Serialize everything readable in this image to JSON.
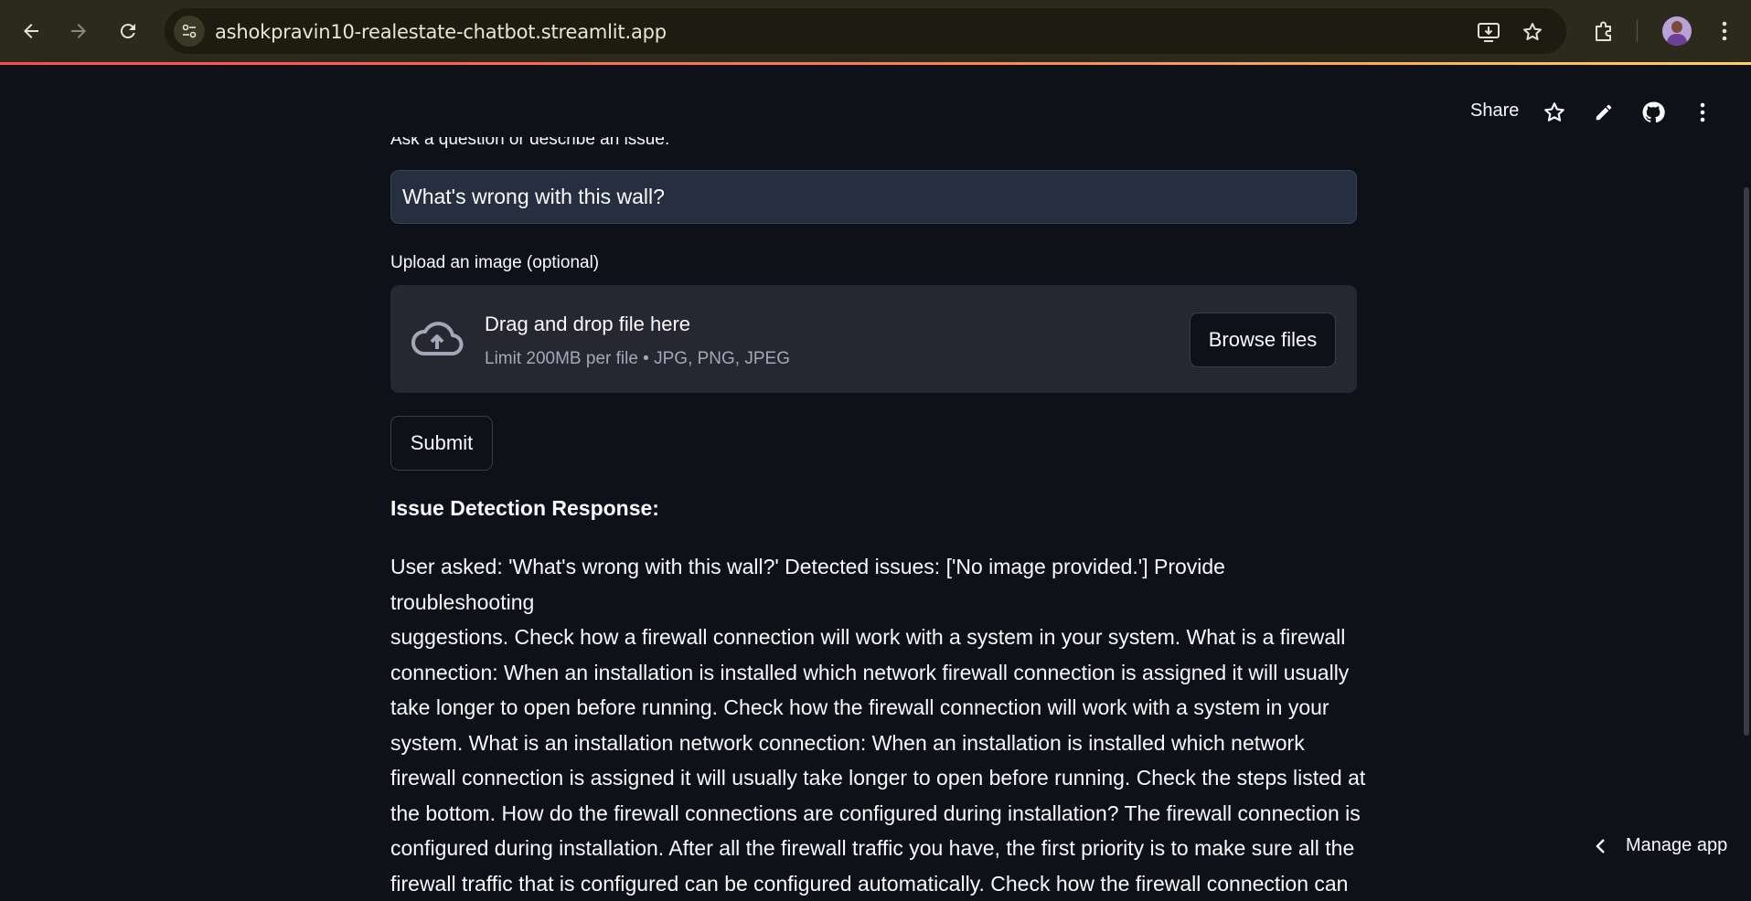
{
  "browser": {
    "url": "ashokpravin10-realestate-chatbot.streamlit.app"
  },
  "toolbar": {
    "share_label": "Share"
  },
  "form": {
    "question_label": "Ask a question or describe an issue:",
    "question_value": "What's wrong with this wall?",
    "upload_label": "Upload an image (optional)",
    "dropzone_title": "Drag and drop file here",
    "dropzone_limit": "Limit 200MB per file • JPG, PNG, JPEG",
    "browse_label": "Browse files",
    "submit_label": "Submit"
  },
  "response": {
    "heading": "Issue Detection Response:",
    "lines": [
      "User asked: 'What's wrong with this wall?' Detected issues: ['No image provided.'] Provide troubleshooting",
      "suggestions. Check how a firewall connection will work with a system in your system. What is a firewall",
      "connection: When an installation is installed which network firewall connection is assigned it will usually",
      "take longer to open before running. Check how the firewall connection will work with a system in your",
      "system. What is an installation network connection: When an installation is installed which network",
      "firewall connection is assigned it will usually take longer to open before running. Check the steps listed at",
      "the bottom. How do the firewall connections are configured during installation? The firewall connection is",
      "configured during installation. After all the firewall traffic you have, the first priority is to make sure all the",
      "firewall traffic that is configured can be configured automatically. Check how the firewall connection can"
    ]
  },
  "footer": {
    "manage_app_label": "Manage app"
  }
}
